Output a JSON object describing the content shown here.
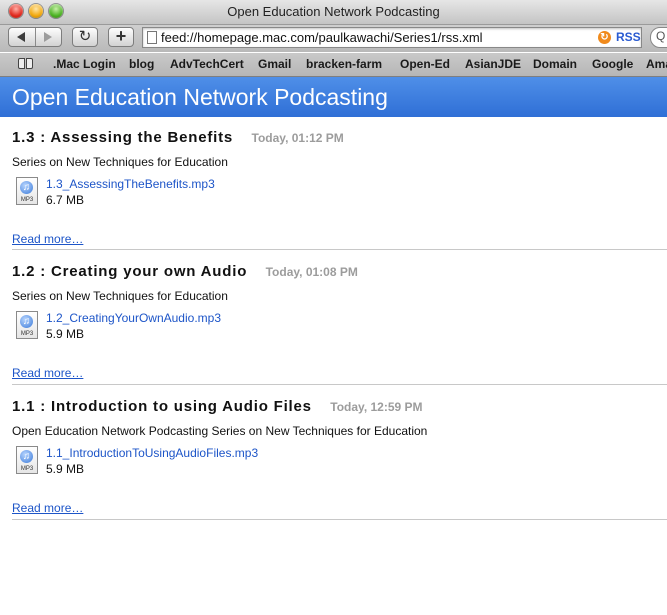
{
  "window": {
    "title": "Open Education Network Podcasting"
  },
  "toolbar": {
    "url": "feed://homepage.mac.com/paulkawachi/Series1/rss.xml",
    "rss_label": "RSS",
    "reload_glyph": "↻",
    "add_glyph": "+",
    "search_glyph": "Q"
  },
  "bookmarks": [
    ".Mac Login",
    "blog",
    "AdvTechCert",
    "Gmail",
    "bracken-farm",
    "Open-Ed",
    "AsianJDE",
    "Domain",
    "Google",
    "Ama"
  ],
  "banner": {
    "title": "Open Education Network Podcasting"
  },
  "articles": [
    {
      "title": "1.3 : Assessing the Benefits",
      "date": "Today, 01:12 PM",
      "description": "Series on New Techniques for Education",
      "enclosure": {
        "file": "1.3_AssessingTheBenefits.mp3",
        "size": "6.7 MB",
        "icon": "mp3-file-icon",
        "icon_label": "MP3"
      },
      "read_more": "Read more…"
    },
    {
      "title": "1.2 : Creating your own Audio",
      "date": "Today, 01:08 PM",
      "description": "Series on New Techniques for Education",
      "enclosure": {
        "file": "1.2_CreatingYourOwnAudio.mp3",
        "size": "5.9 MB",
        "icon": "mp3-file-icon",
        "icon_label": "MP3"
      },
      "read_more": "Read more…"
    },
    {
      "title": "1.1 : Introduction to using Audio Files",
      "date": "Today, 12:59 PM",
      "description": "Open Education Network Podcasting Series on New Techniques for Education",
      "enclosure": {
        "file": "1.1_IntroductionToUsingAudioFiles.mp3",
        "size": "5.9 MB",
        "icon": "mp3-file-icon",
        "icon_label": "MP3"
      },
      "read_more": "Read more…"
    }
  ],
  "colors": {
    "banner": "#3a7be0",
    "link": "#1d55c8",
    "date": "#9c9c9c"
  }
}
